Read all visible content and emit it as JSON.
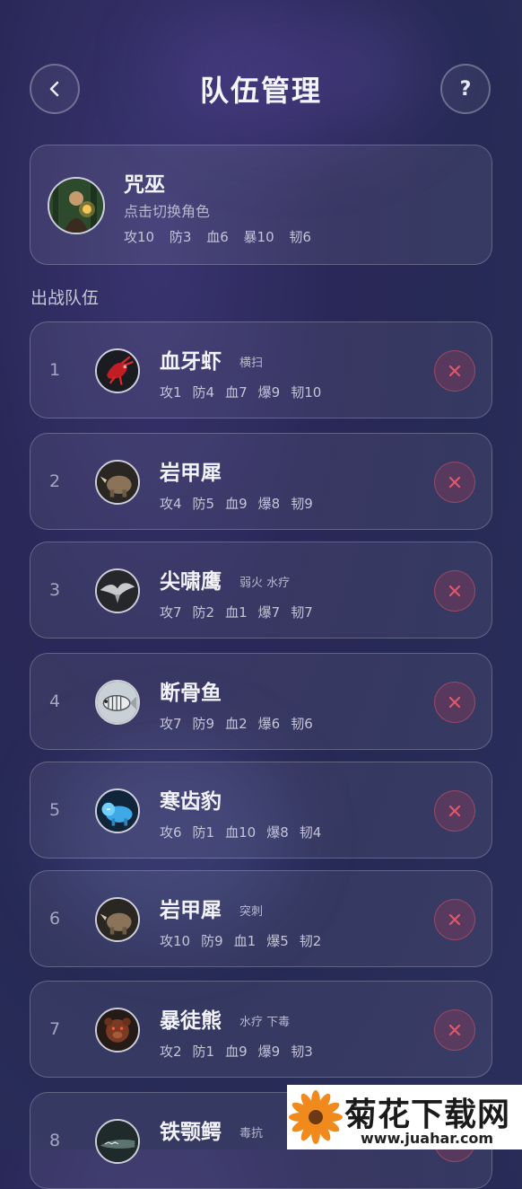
{
  "header": {
    "title": "队伍管理",
    "back_icon": "‹",
    "help_icon": "?"
  },
  "leader": {
    "name": "咒巫",
    "hint": "点击切换角色",
    "stats": [
      "攻10",
      "防3",
      "血6",
      "暴10",
      "韧6"
    ]
  },
  "section_title": "出战队伍",
  "team": [
    {
      "index": "1",
      "name": "血牙虾",
      "skill": "横扫",
      "stats": [
        "攻1",
        "防4",
        "血7",
        "爆9",
        "韧10"
      ],
      "icon": "red-shrimp-icon"
    },
    {
      "index": "2",
      "name": "岩甲犀",
      "skill": "",
      "stats": [
        "攻4",
        "防5",
        "血9",
        "爆8",
        "韧9"
      ],
      "icon": "rhino-icon"
    },
    {
      "index": "3",
      "name": "尖啸鹰",
      "skill": "弱火 水疗",
      "stats": [
        "攻7",
        "防2",
        "血1",
        "爆7",
        "韧7"
      ],
      "icon": "eagle-icon"
    },
    {
      "index": "4",
      "name": "断骨鱼",
      "skill": "",
      "stats": [
        "攻7",
        "防9",
        "血2",
        "爆6",
        "韧6"
      ],
      "icon": "bone-fish-icon"
    },
    {
      "index": "5",
      "name": "寒齿豹",
      "skill": "",
      "stats": [
        "攻6",
        "防1",
        "血10",
        "爆8",
        "韧4"
      ],
      "icon": "ice-leopard-icon"
    },
    {
      "index": "6",
      "name": "岩甲犀",
      "skill": "突刺",
      "stats": [
        "攻10",
        "防9",
        "血1",
        "爆5",
        "韧2"
      ],
      "icon": "rhino-icon"
    },
    {
      "index": "7",
      "name": "暴徒熊",
      "skill": "水疗 下毒",
      "stats": [
        "攻2",
        "防1",
        "血9",
        "爆9",
        "韧3"
      ],
      "icon": "bear-icon"
    },
    {
      "index": "8",
      "name": "铁颚鳄",
      "skill": "毒抗",
      "stats": [],
      "icon": "crocodile-icon"
    }
  ],
  "watermark": {
    "brand": "菊花下载网",
    "url": "www.juahar.com"
  },
  "colors": {
    "accent_red": "#e0566a",
    "background": "#2a2858"
  }
}
